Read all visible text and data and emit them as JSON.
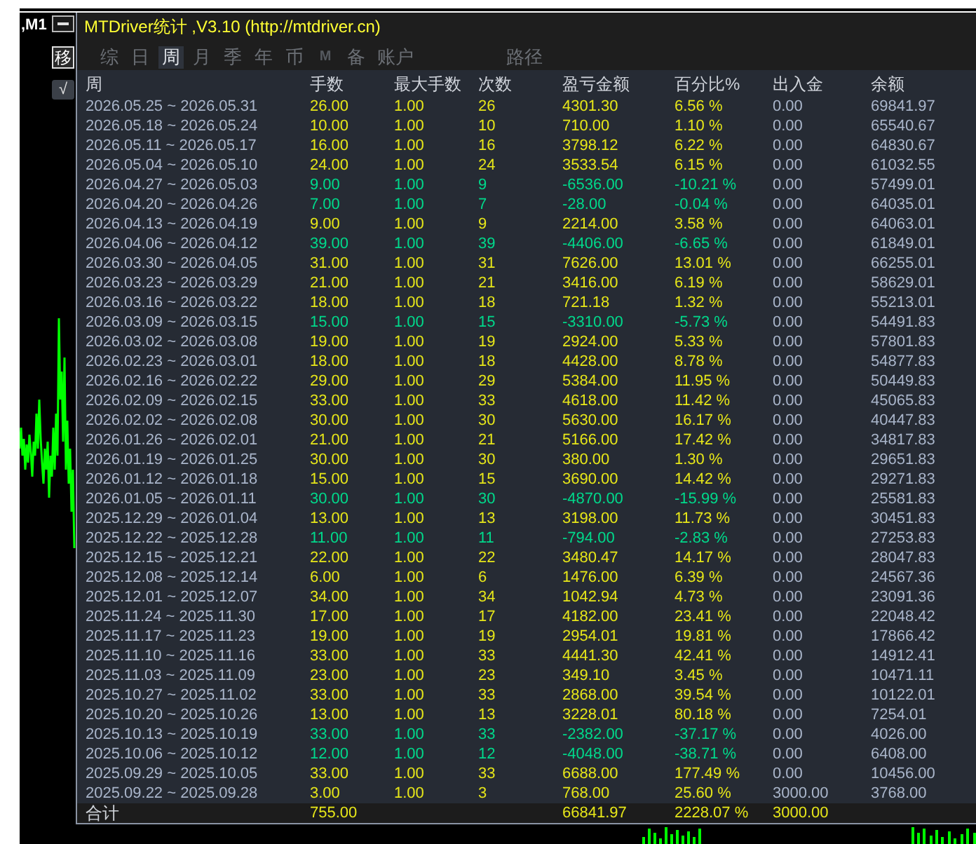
{
  "chart": {
    "symbol_label": ",M1"
  },
  "side_buttons": [
    {
      "kind": "minimize"
    },
    {
      "kind": "boxed",
      "label": "移"
    },
    {
      "kind": "toggle",
      "label": "√"
    }
  ],
  "window": {
    "title": "MTDriver统计 ,V3.10 (http://mtdriver.cn)"
  },
  "tabs": [
    {
      "label": "综",
      "kind": "text",
      "selected": false
    },
    {
      "label": "日",
      "kind": "text",
      "selected": false
    },
    {
      "label": "周",
      "kind": "text",
      "selected": true
    },
    {
      "label": "月",
      "kind": "text",
      "selected": false
    },
    {
      "label": "季",
      "kind": "text",
      "selected": false
    },
    {
      "label": "年",
      "kind": "text",
      "selected": false
    },
    {
      "label": "币",
      "kind": "text",
      "selected": false
    },
    {
      "label": "M",
      "kind": "letter",
      "selected": false
    },
    {
      "label": "备",
      "kind": "text",
      "selected": false
    },
    {
      "label": "账户",
      "kind": "text",
      "selected": false
    }
  ],
  "path_button": {
    "label": "路径"
  },
  "table": {
    "columns": [
      "周",
      "手数",
      "最大手数",
      "次数",
      "盈亏金额",
      "百分比%",
      "出入金",
      "余额"
    ],
    "rows": [
      {
        "cells": [
          "2026.05.25 ~ 2026.05.31",
          "26.00",
          "1.00",
          "26",
          "4301.30",
          "6.56 %",
          "0.00",
          "69841.97"
        ],
        "loss": false
      },
      {
        "cells": [
          "2026.05.18 ~ 2026.05.24",
          "10.00",
          "1.00",
          "10",
          "710.00",
          "1.10 %",
          "0.00",
          "65540.67"
        ],
        "loss": false
      },
      {
        "cells": [
          "2026.05.11 ~ 2026.05.17",
          "16.00",
          "1.00",
          "16",
          "3798.12",
          "6.22 %",
          "0.00",
          "64830.67"
        ],
        "loss": false
      },
      {
        "cells": [
          "2026.05.04 ~ 2026.05.10",
          "24.00",
          "1.00",
          "24",
          "3533.54",
          "6.15 %",
          "0.00",
          "61032.55"
        ],
        "loss": false
      },
      {
        "cells": [
          "2026.04.27 ~ 2026.05.03",
          "9.00",
          "1.00",
          "9",
          "-6536.00",
          "-10.21 %",
          "0.00",
          "57499.01"
        ],
        "loss": true
      },
      {
        "cells": [
          "2026.04.20 ~ 2026.04.26",
          "7.00",
          "1.00",
          "7",
          "-28.00",
          "-0.04 %",
          "0.00",
          "64035.01"
        ],
        "loss": true
      },
      {
        "cells": [
          "2026.04.13 ~ 2026.04.19",
          "9.00",
          "1.00",
          "9",
          "2214.00",
          "3.58 %",
          "0.00",
          "64063.01"
        ],
        "loss": false
      },
      {
        "cells": [
          "2026.04.06 ~ 2026.04.12",
          "39.00",
          "1.00",
          "39",
          "-4406.00",
          "-6.65 %",
          "0.00",
          "61849.01"
        ],
        "loss": true
      },
      {
        "cells": [
          "2026.03.30 ~ 2026.04.05",
          "31.00",
          "1.00",
          "31",
          "7626.00",
          "13.01 %",
          "0.00",
          "66255.01"
        ],
        "loss": false
      },
      {
        "cells": [
          "2026.03.23 ~ 2026.03.29",
          "21.00",
          "1.00",
          "21",
          "3416.00",
          "6.19 %",
          "0.00",
          "58629.01"
        ],
        "loss": false
      },
      {
        "cells": [
          "2026.03.16 ~ 2026.03.22",
          "18.00",
          "1.00",
          "18",
          "721.18",
          "1.32 %",
          "0.00",
          "55213.01"
        ],
        "loss": false
      },
      {
        "cells": [
          "2026.03.09 ~ 2026.03.15",
          "15.00",
          "1.00",
          "15",
          "-3310.00",
          "-5.73 %",
          "0.00",
          "54491.83"
        ],
        "loss": true
      },
      {
        "cells": [
          "2026.03.02 ~ 2026.03.08",
          "19.00",
          "1.00",
          "19",
          "2924.00",
          "5.33 %",
          "0.00",
          "57801.83"
        ],
        "loss": false
      },
      {
        "cells": [
          "2026.02.23 ~ 2026.03.01",
          "18.00",
          "1.00",
          "18",
          "4428.00",
          "8.78 %",
          "0.00",
          "54877.83"
        ],
        "loss": false
      },
      {
        "cells": [
          "2026.02.16 ~ 2026.02.22",
          "29.00",
          "1.00",
          "29",
          "5384.00",
          "11.95 %",
          "0.00",
          "50449.83"
        ],
        "loss": false
      },
      {
        "cells": [
          "2026.02.09 ~ 2026.02.15",
          "33.00",
          "1.00",
          "33",
          "4618.00",
          "11.42 %",
          "0.00",
          "45065.83"
        ],
        "loss": false
      },
      {
        "cells": [
          "2026.02.02 ~ 2026.02.08",
          "30.00",
          "1.00",
          "30",
          "5630.00",
          "16.17 %",
          "0.00",
          "40447.83"
        ],
        "loss": false
      },
      {
        "cells": [
          "2026.01.26 ~ 2026.02.01",
          "21.00",
          "1.00",
          "21",
          "5166.00",
          "17.42 %",
          "0.00",
          "34817.83"
        ],
        "loss": false
      },
      {
        "cells": [
          "2026.01.19 ~ 2026.01.25",
          "30.00",
          "1.00",
          "30",
          "380.00",
          "1.30 %",
          "0.00",
          "29651.83"
        ],
        "loss": false
      },
      {
        "cells": [
          "2026.01.12 ~ 2026.01.18",
          "15.00",
          "1.00",
          "15",
          "3690.00",
          "14.42 %",
          "0.00",
          "29271.83"
        ],
        "loss": false
      },
      {
        "cells": [
          "2026.01.05 ~ 2026.01.11",
          "30.00",
          "1.00",
          "30",
          "-4870.00",
          "-15.99 %",
          "0.00",
          "25581.83"
        ],
        "loss": true
      },
      {
        "cells": [
          "2025.12.29 ~ 2026.01.04",
          "13.00",
          "1.00",
          "13",
          "3198.00",
          "11.73 %",
          "0.00",
          "30451.83"
        ],
        "loss": false
      },
      {
        "cells": [
          "2025.12.22 ~ 2025.12.28",
          "11.00",
          "1.00",
          "11",
          "-794.00",
          "-2.83 %",
          "0.00",
          "27253.83"
        ],
        "loss": true
      },
      {
        "cells": [
          "2025.12.15 ~ 2025.12.21",
          "22.00",
          "1.00",
          "22",
          "3480.47",
          "14.17 %",
          "0.00",
          "28047.83"
        ],
        "loss": false
      },
      {
        "cells": [
          "2025.12.08 ~ 2025.12.14",
          "6.00",
          "1.00",
          "6",
          "1476.00",
          "6.39 %",
          "0.00",
          "24567.36"
        ],
        "loss": false
      },
      {
        "cells": [
          "2025.12.01 ~ 2025.12.07",
          "34.00",
          "1.00",
          "34",
          "1042.94",
          "4.73 %",
          "0.00",
          "23091.36"
        ],
        "loss": false
      },
      {
        "cells": [
          "2025.11.24 ~ 2025.11.30",
          "17.00",
          "1.00",
          "17",
          "4182.00",
          "23.41 %",
          "0.00",
          "22048.42"
        ],
        "loss": false
      },
      {
        "cells": [
          "2025.11.17 ~ 2025.11.23",
          "19.00",
          "1.00",
          "19",
          "2954.01",
          "19.81 %",
          "0.00",
          "17866.42"
        ],
        "loss": false
      },
      {
        "cells": [
          "2025.11.10 ~ 2025.11.16",
          "33.00",
          "1.00",
          "33",
          "4441.30",
          "42.41 %",
          "0.00",
          "14912.41"
        ],
        "loss": false
      },
      {
        "cells": [
          "2025.11.03 ~ 2025.11.09",
          "23.00",
          "1.00",
          "23",
          "349.10",
          "3.45 %",
          "0.00",
          "10471.11"
        ],
        "loss": false
      },
      {
        "cells": [
          "2025.10.27 ~ 2025.11.02",
          "33.00",
          "1.00",
          "33",
          "2868.00",
          "39.54 %",
          "0.00",
          "10122.01"
        ],
        "loss": false
      },
      {
        "cells": [
          "2025.10.20 ~ 2025.10.26",
          "13.00",
          "1.00",
          "13",
          "3228.01",
          "80.18 %",
          "0.00",
          "7254.01"
        ],
        "loss": false
      },
      {
        "cells": [
          "2025.10.13 ~ 2025.10.19",
          "33.00",
          "1.00",
          "33",
          "-2382.00",
          "-37.17 %",
          "0.00",
          "4026.00"
        ],
        "loss": true
      },
      {
        "cells": [
          "2025.10.06 ~ 2025.10.12",
          "12.00",
          "1.00",
          "12",
          "-4048.00",
          "-38.71 %",
          "0.00",
          "6408.00"
        ],
        "loss": true
      },
      {
        "cells": [
          "2025.09.29 ~ 2025.10.05",
          "33.00",
          "1.00",
          "33",
          "6688.00",
          "177.49 %",
          "0.00",
          "10456.00"
        ],
        "loss": false
      },
      {
        "cells": [
          "2025.09.22 ~ 2025.09.28",
          "3.00",
          "1.00",
          "3",
          "768.00",
          "25.60 %",
          "3000.00",
          "3768.00"
        ],
        "loss": false
      }
    ],
    "total": {
      "label": "合计",
      "lots": "755.00",
      "profit": "66841.97",
      "percent": "2228.07 %",
      "deposit": "3000.00"
    }
  }
}
